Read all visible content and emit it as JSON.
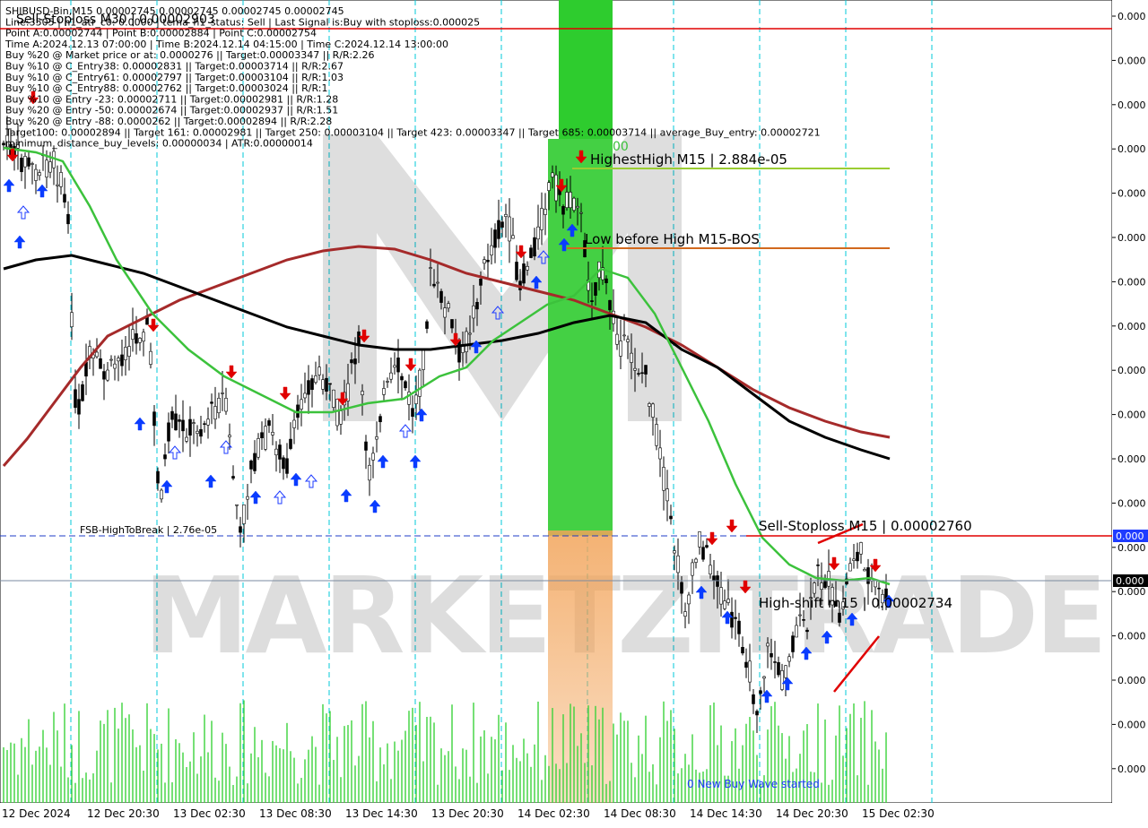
{
  "chart_data": {
    "type": "line",
    "symbol": "SHIBUSD-Bin,M15",
    "header": {
      "ohlc_line": "SHIBUSD-Bin,M15  0.00002745 0.00002745 0.00002745 0.00002745",
      "info_lines": [
        "Line:3505 | h1_atr_c0: 0.0000 | tema_h1_status: Sell | Last Signal is:Buy with stoploss:0.000025",
        "Point A:0.00002744 | Point B:0.00002884 | Point C:0.00002754",
        "Time A:2024.12.13 07:00:00 | Time B:2024.12.14 04:15:00 | Time C:2024.12.14 13:00:00",
        "Buy %20 @ Market price or at: 0.0000276 || Target:0.00003347 || R/R:2.26",
        "Buy %10 @ C_Entry38: 0.00002831 || Target:0.00003714 || R/R:2.67",
        "Buy %10 @ C_Entry61: 0.00002797 || Target:0.00003104 || R/R:1.03",
        "Buy %10 @ C_Entry88: 0.00002762 || Target:0.00003024 || R/R:1",
        "Buy %10 @ Entry -23: 0.00002711 || Target:0.00002981 || R/R:1.28",
        "Buy %20 @ Entry -50: 0.00002674 || Target:0.00002937 || R/R:1.51",
        "Buy %20 @ Entry -88: 0.0000262 || Target:0.00002894 || R/R:2.28",
        "Target100: 0.00002894 || Target 161: 0.00002981 || Target 250: 0.00003104 || Target 423: 0.00003347 || Target 685: 0.00003714 || average_Buy_entry: 0.00002721",
        "minimum_distance_buy_levels: 0.00000034 | ATR:0.00000014"
      ],
      "overlay_label": "Sell-Stoploss M30 | 0.00002903"
    },
    "annotations": {
      "highest_high": "HighestHigh   M15 | 2.884e-05",
      "low_before_high": "Low before High   M15-BOS",
      "sell_stoploss": "Sell-Stoploss M15 | 0.00002760",
      "high_shift": "High-shift m15 | 0.00002734",
      "fsb_label": "FSB-HighToBreak | 2.76e-05",
      "zone_label": "00",
      "wave_label": "0 New Buy Wave started",
      "watermark": "MARKETZITRADE"
    },
    "x_labels": [
      "12 Dec 2024",
      "12 Dec 20:30",
      "13 Dec 02:30",
      "13 Dec 08:30",
      "13 Dec 14:30",
      "13 Dec 20:30",
      "14 Dec 02:30",
      "14 Dec 08:30",
      "14 Dec 14:30",
      "14 Dec 20:30",
      "15 Dec 02:30"
    ],
    "y_labels": [
      "0.000",
      "0.000",
      "0.000",
      "0.000",
      "0.000",
      "0.000",
      "0.000",
      "0.000",
      "0.000",
      "0.000",
      "0.000",
      "0.000",
      "0.000",
      "0.000",
      "0.000",
      "0.000",
      "0.000",
      "0.000"
    ],
    "price_tags": [
      "0.000",
      "0.000"
    ],
    "grid": true,
    "colors": {
      "ma_green": "#3cc23c",
      "ma_brown": "#a52a2a",
      "ma_black": "#000000",
      "stoploss_red": "#e00000",
      "buy_arrow": "#0a3cff",
      "sell_arrow": "#e00000",
      "zone_green": "#2ecc2e",
      "zone_orange": "#f0a050",
      "tag_blue": "#1f3cff"
    }
  }
}
